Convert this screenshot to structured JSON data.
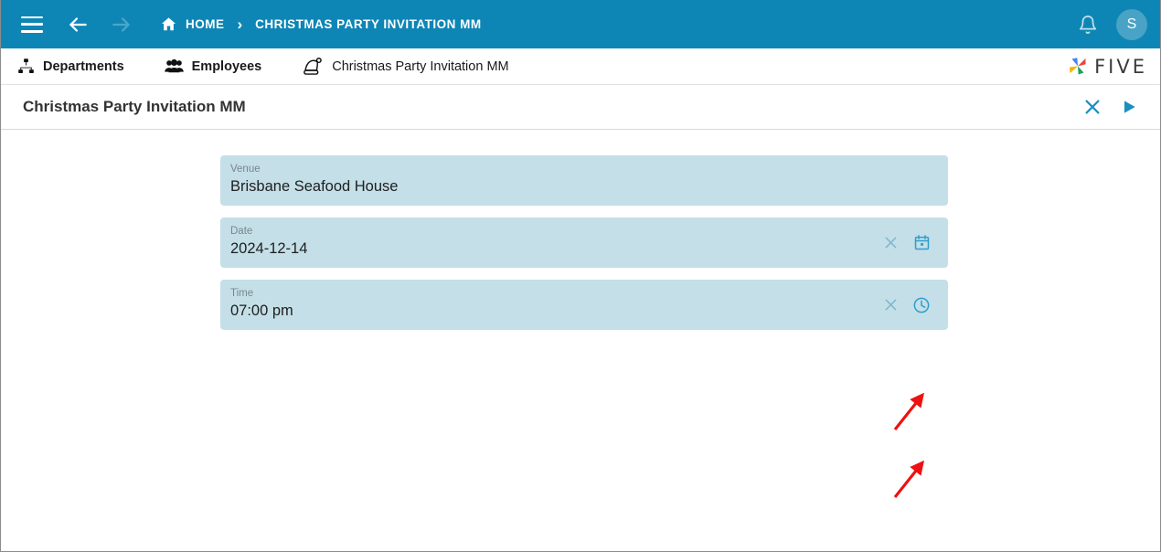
{
  "colors": {
    "appbar": "#0e86b5",
    "field_bg": "#c4dfe8",
    "accent": "#1b8fc0",
    "annotation": "#ee1111",
    "avatar_bg": "#49a3c6"
  },
  "appbar": {
    "menu_icon": "hamburger-menu-icon",
    "back_icon": "arrow-left-icon",
    "forward_icon": "arrow-right-icon",
    "home_icon": "home-icon",
    "home_label": "HOME",
    "separator": "›",
    "current_label": "CHRISTMAS PARTY INVITATION MM",
    "bell_icon": "bell-icon",
    "avatar_initial": "S"
  },
  "tabs": [
    {
      "label": "Departments",
      "icon": "sitemap-icon",
      "bold": true
    },
    {
      "label": "Employees",
      "icon": "users-group-icon",
      "bold": true
    },
    {
      "label": "Christmas Party Invitation MM",
      "icon": "santa-hat-icon",
      "bold": false
    }
  ],
  "brand": {
    "name": "FIVE",
    "mark_icon": "five-pinwheel-logo-icon"
  },
  "form": {
    "title": "Christmas Party Invitation MM",
    "close_icon": "close-x-icon",
    "submit_icon": "play-triangle-icon",
    "fields": [
      {
        "label": "Venue",
        "value": "Brisbane Seafood House",
        "clear_icon": null,
        "picker_icon": null
      },
      {
        "label": "Date",
        "value": "2024-12-14",
        "clear_icon": "clear-x-icon",
        "picker_icon": "calendar-icon"
      },
      {
        "label": "Time",
        "value": "07:00 pm",
        "clear_icon": "clear-x-icon",
        "picker_icon": "clock-icon"
      }
    ]
  },
  "annotations": [
    {
      "name": "arrow-to-calendar-icon",
      "points_to": "calendar-icon"
    },
    {
      "name": "arrow-to-clock-icon",
      "points_to": "clock-icon"
    }
  ]
}
